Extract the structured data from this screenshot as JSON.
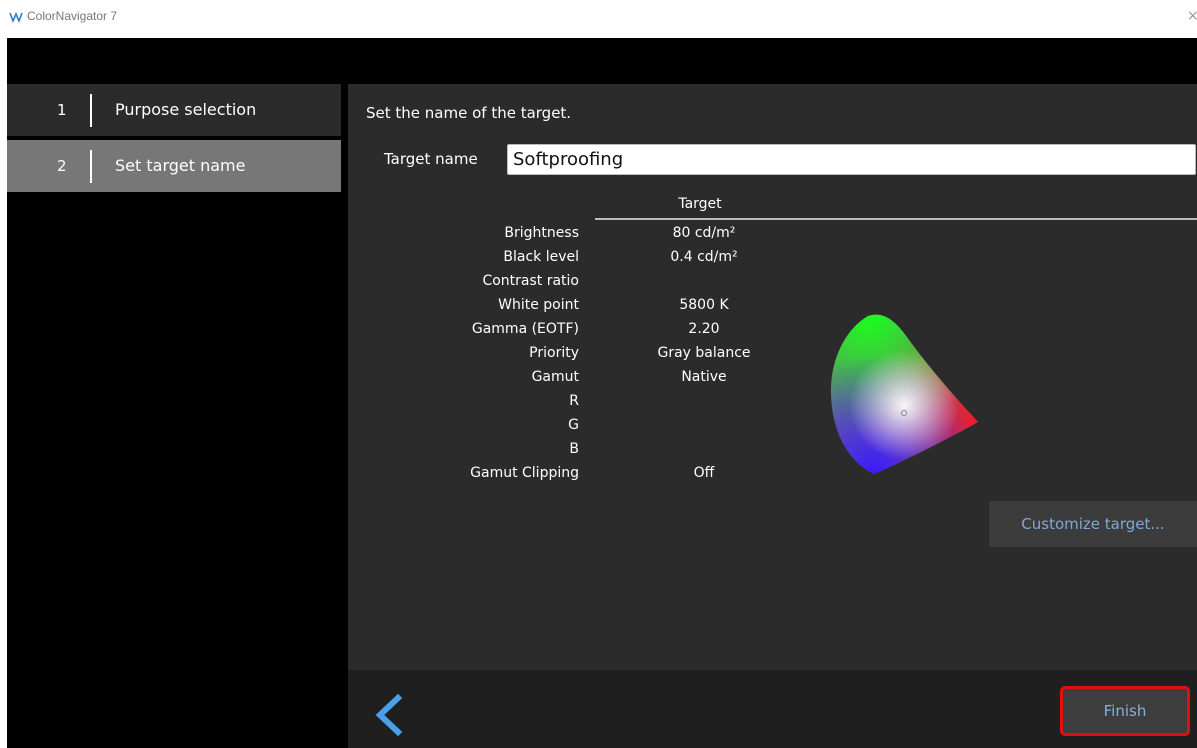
{
  "window": {
    "title": "ColorNavigator 7",
    "close_glyph": "×"
  },
  "steps": [
    {
      "number": "1",
      "label": "Purpose selection",
      "active": false
    },
    {
      "number": "2",
      "label": "Set target name",
      "active": true
    }
  ],
  "content": {
    "instruction": "Set the name of the target.",
    "target_name_label": "Target name",
    "target_name_value": "Softproofing",
    "column_header": "Target",
    "rows": [
      {
        "label": "Brightness",
        "value": "80 cd/m²"
      },
      {
        "label": "Black level",
        "value": "0.4 cd/m²"
      },
      {
        "label": "Contrast ratio",
        "value": ""
      },
      {
        "label": "White point",
        "value": "5800 K"
      },
      {
        "label": "Gamma (EOTF)",
        "value": "2.20"
      },
      {
        "label": "Priority",
        "value": "Gray balance"
      },
      {
        "label": "Gamut",
        "value": "Native"
      },
      {
        "label": "R",
        "value": ""
      },
      {
        "label": "G",
        "value": ""
      },
      {
        "label": "B",
        "value": ""
      },
      {
        "label": "Gamut Clipping",
        "value": "Off"
      }
    ],
    "customize_button": "Customize target..."
  },
  "footer": {
    "back_icon": "chevron-left-icon",
    "finish_button": "Finish",
    "highlight_color": "#e01010"
  },
  "colors": {
    "accent": "#4a9fe8",
    "button_text": "#7fa7d4"
  }
}
